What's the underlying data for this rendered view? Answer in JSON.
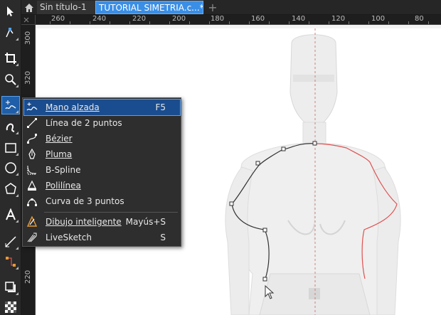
{
  "tabs": [
    {
      "label": "Sin título-1"
    },
    {
      "label": "TUTORIAL SIMETRIA.c...*"
    }
  ],
  "ruler": {
    "top_labels": [
      "260",
      "240",
      "220",
      "200",
      "180",
      "160",
      "140",
      "120",
      "100",
      "80"
    ],
    "left_labels": [
      "300",
      "320",
      "220"
    ]
  },
  "flyout": {
    "items": [
      {
        "label": "Mano alzada",
        "shortcut": "F5",
        "icon": "freehand-icon"
      },
      {
        "label": "Línea de 2 puntos",
        "shortcut": "",
        "icon": "two-point-line-icon"
      },
      {
        "label": "Bézier",
        "shortcut": "",
        "icon": "bezier-icon"
      },
      {
        "label": "Pluma",
        "shortcut": "",
        "icon": "pen-icon"
      },
      {
        "label": "B-Spline",
        "shortcut": "",
        "icon": "bspline-icon"
      },
      {
        "label": "Polilínea",
        "shortcut": "",
        "icon": "polyline-icon"
      },
      {
        "label": "Curva de 3 puntos",
        "shortcut": "",
        "icon": "three-point-curve-icon"
      },
      {
        "label": "Dibujo inteligente",
        "shortcut": "Mayús+S",
        "icon": "smart-drawing-icon"
      },
      {
        "label": "LiveSketch",
        "shortcut": "S",
        "icon": "livesketch-icon"
      }
    ]
  },
  "colors": {
    "accent": "#1a4d8f",
    "mirror_line": "#e05050",
    "guide": "#d08080"
  }
}
